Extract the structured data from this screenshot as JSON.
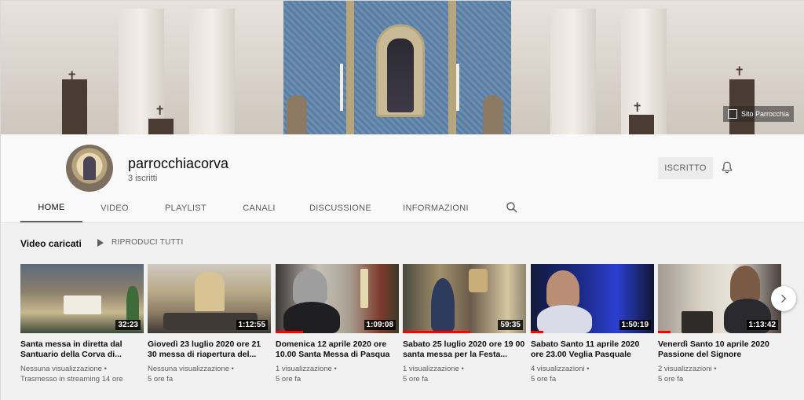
{
  "banner": {
    "site_link": "Sito Parrocchia"
  },
  "channel": {
    "name": "parrocchiacorva",
    "subscribers": "3 iscritti",
    "subscribe_label": "ISCRITTO"
  },
  "tabs": [
    {
      "label": "HOME",
      "active": true
    },
    {
      "label": "VIDEO"
    },
    {
      "label": "PLAYLIST"
    },
    {
      "label": "CANALI"
    },
    {
      "label": "DISCUSSIONE"
    },
    {
      "label": "INFORMAZIONI"
    }
  ],
  "section": {
    "title": "Video caricati",
    "play_all": "RIPRODUCI TUTTI"
  },
  "videos": [
    {
      "title": "Santa messa in diretta dal Santuario della Corva di...",
      "duration": "32:23",
      "views": "Nessuna visualizzazione •",
      "time": "Trasmesso in streaming 14 ore",
      "progress": 0
    },
    {
      "title": "Giovedì 23 luglio 2020 ore 21 30 messa di riapertura del...",
      "duration": "1:12:55",
      "views": "Nessuna visualizzazione •",
      "time": "5 ore fa",
      "progress": 0
    },
    {
      "title": "Domenica 12 aprile 2020 ore 10.00 Santa Messa di Pasqua",
      "duration": "1:09:08",
      "views": "1 visualizzazione •",
      "time": "5 ore fa",
      "progress": 0.22
    },
    {
      "title": "Sabato 25 luglio 2020 ore 19 00 santa messa per la Festa...",
      "duration": "59:35",
      "views": "1 visualizzazione •",
      "time": "5 ore fa",
      "progress": 0.55
    },
    {
      "title": "Sabato Santo 11 aprile 2020 ore 23.00 Veglia Pasquale",
      "duration": "1:50:19",
      "views": "4 visualizzazioni •",
      "time": "5 ore fa",
      "progress": 0.1
    },
    {
      "title": "Venerdì Santo 10 aprile 2020 Passione del Signore",
      "duration": "1:13:42",
      "views": "2 visualizzazioni •",
      "time": "5 ore fa",
      "progress": 0.1
    }
  ],
  "icons": {
    "bell": "bell-icon",
    "search": "search-icon",
    "play": "play-icon",
    "next": "chevron-right-icon"
  }
}
